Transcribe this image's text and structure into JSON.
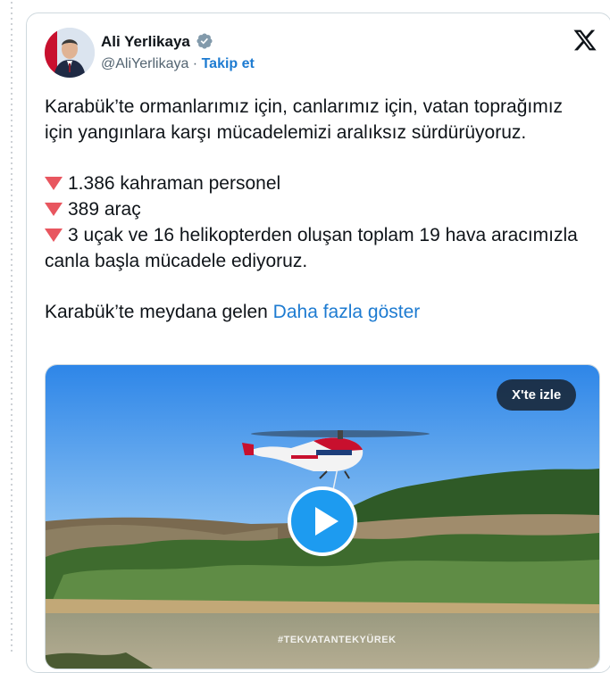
{
  "author": {
    "name": "Ali Yerlikaya",
    "handle": "@AliYerlikaya",
    "separator": " · ",
    "follow_label": "Takip et",
    "verified_icon": "verified-badge-icon",
    "avatar_icon": "profile-avatar"
  },
  "tweet": {
    "intro": "Karabük’te ormanlarımız için, canlarımız için, vatan toprağımız için yangınlara karşı mücadelemizi aralıksız sürdürüyoruz.",
    "bullets": [
      "1.386 kahraman personel",
      "389 araç",
      "3 uçak ve 16 helikopterden oluşan toplam 19 hava aracımızla canla başla mücadele ediyoruz."
    ],
    "bullet_icon": "red-triangle-down-icon",
    "tail": "Karabük’te meydana gelen ",
    "show_more": "Daha fazla göster"
  },
  "media": {
    "watch_label": "X'te izle",
    "hashtag_overlay": "#TEKVATANTEKYÜREK",
    "play_icon": "play-icon"
  },
  "colors": {
    "accent": "#1d7bd1",
    "play_button": "#1d9bf0",
    "bullet": "#e8565f",
    "text": "#0f1419",
    "muted": "#536471"
  }
}
